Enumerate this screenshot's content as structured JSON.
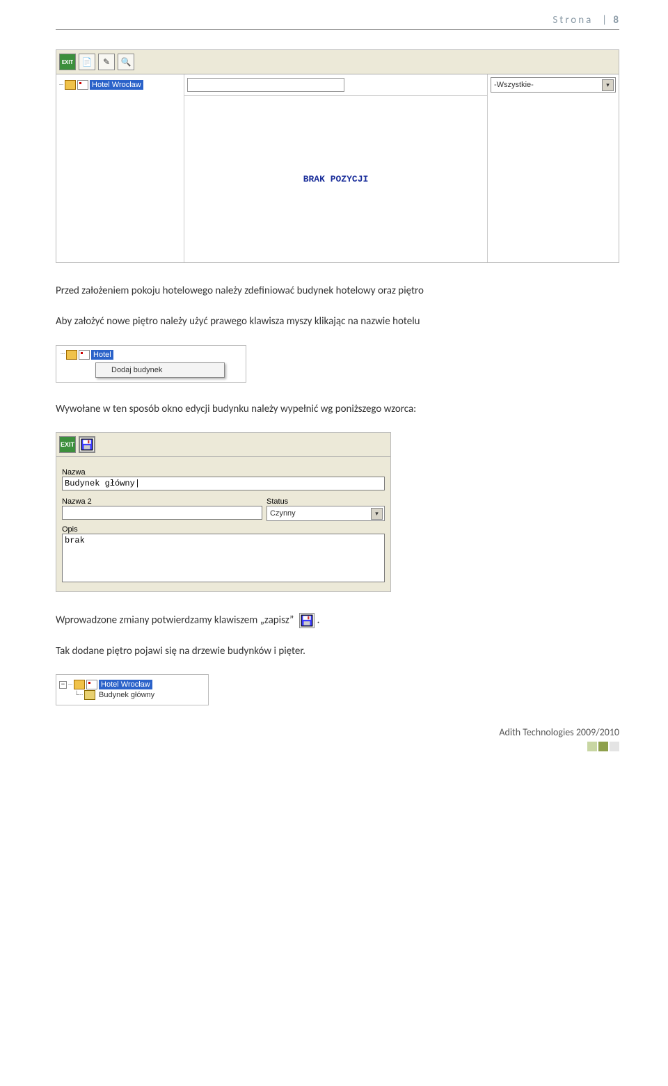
{
  "page_header": {
    "label": "Strona",
    "number": "8"
  },
  "screenshot1": {
    "toolbar": {
      "exit": "EXIT"
    },
    "tree": {
      "hotel_name": "Hotel Wrocław"
    },
    "dropdown_value": "-Wszystkie-",
    "empty_msg": "BRAK POZYCJI"
  },
  "para1": "Przed założeniem pokoju hotelowego należy zdefiniować budynek hotelowy oraz piętro",
  "para2": "Aby założyć nowe piętro należy użyć prawego klawisza myszy klikając na nazwie hotelu",
  "context_menu": {
    "hotel_label": "Hotel",
    "item": "Dodaj budynek"
  },
  "para3": "Wywołane w ten sposób okno edycji budynku należy wypełnić wg poniższego wzorca:",
  "edit_form": {
    "toolbar_exit": "EXIT",
    "label_nazwa": "Nazwa",
    "value_nazwa": "Budynek główny|",
    "label_nazwa2": "Nazwa 2",
    "value_nazwa2": "",
    "label_status": "Status",
    "value_status": "Czynny",
    "label_opis": "Opis",
    "value_opis": "brak"
  },
  "para4_a": "Wprowadzone zmiany potwierdzamy klawiszem „zapisz”",
  "para4_b": ".",
  "para5": "Tak dodane piętro pojawi się na drzewie budynków i pięter.",
  "tree2": {
    "hotel": "Hotel Wrocław",
    "building": "Budynek główny"
  },
  "footer": "Adith Technologies 2009/2010"
}
